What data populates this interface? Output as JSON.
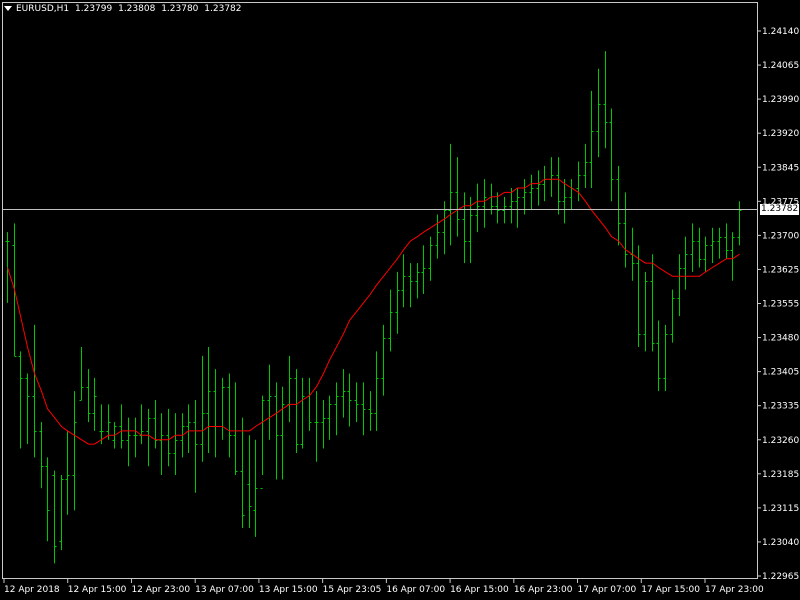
{
  "header": {
    "symbol": "EURUSD,H1",
    "ohlc": [
      "1.23799",
      "1.23808",
      "1.23780",
      "1.23782"
    ]
  },
  "current_price_label": "1.23782",
  "colors": {
    "background": "#000000",
    "bar": "#00c800",
    "moving_average": "#ff0000",
    "axis_text": "#ffffff",
    "frame": "#c8c8c8",
    "price_line": "#c0c0c0"
  },
  "chart_data": {
    "type": "ohlc",
    "title": "EURUSD,H1",
    "ylim": [
      1.22965,
      1.24215
    ],
    "y_ticks": [
      "1.24140",
      "1.24065",
      "1.23990",
      "1.23920",
      "1.23845",
      "1.23775",
      "1.23700",
      "1.23625",
      "1.23555",
      "1.23480",
      "1.23405",
      "1.23335",
      "1.23260",
      "1.23185",
      "1.23115",
      "1.23040",
      "1.22965"
    ],
    "x_ticks": [
      "12 Apr 2018",
      "12 Apr 15:00",
      "12 Apr 23:00",
      "13 Apr 07:00",
      "13 Apr 15:00",
      "15 Apr 23:05",
      "16 Apr 07:00",
      "16 Apr 15:00",
      "16 Apr 23:00",
      "17 Apr 07:00",
      "17 Apr 15:00",
      "17 Apr 23:00"
    ],
    "current_price": 1.23782,
    "grid": false,
    "series": [
      {
        "name": "",
        "type": "ohlc",
        "bars": [
          [
            1.2371,
            1.2373,
            1.2357,
            1.2371
          ],
          [
            1.237,
            1.2375,
            1.2345,
            1.2345
          ],
          [
            1.2345,
            1.2346,
            1.2324,
            1.234
          ],
          [
            1.234,
            1.2341,
            1.2325,
            1.2336
          ],
          [
            1.2336,
            1.2352,
            1.2322,
            1.2328
          ],
          [
            1.2328,
            1.233,
            1.2315,
            1.232
          ],
          [
            1.232,
            1.2322,
            1.2303,
            1.231
          ],
          [
            1.2318,
            1.2319,
            1.2298,
            1.2302
          ],
          [
            1.2303,
            1.2318,
            1.2301,
            1.2317
          ],
          [
            1.2317,
            1.2328,
            1.2309,
            1.2318
          ],
          [
            1.2318,
            1.2337,
            1.231,
            1.233
          ],
          [
            1.2335,
            1.2347,
            1.2335,
            1.2338
          ],
          [
            1.2338,
            1.2342,
            1.233,
            1.2332
          ],
          [
            1.2332,
            1.234,
            1.2328,
            1.2336
          ],
          [
            1.2328,
            1.2334,
            1.2325,
            1.2328
          ],
          [
            1.2328,
            1.2334,
            1.2326,
            1.233
          ],
          [
            1.2326,
            1.233,
            1.2324,
            1.2329
          ],
          [
            1.2329,
            1.2334,
            1.2324,
            1.2326
          ],
          [
            1.2326,
            1.2331,
            1.232,
            1.2327
          ],
          [
            1.2327,
            1.2331,
            1.2322,
            1.2327
          ],
          [
            1.2327,
            1.2334,
            1.2325,
            1.2328
          ],
          [
            1.2328,
            1.2333,
            1.232,
            1.2331
          ],
          [
            1.2331,
            1.2335,
            1.2324,
            1.2326
          ],
          [
            1.2326,
            1.2332,
            1.2318,
            1.2327
          ],
          [
            1.2327,
            1.2333,
            1.232,
            1.2323
          ],
          [
            1.2323,
            1.2332,
            1.2318,
            1.2326
          ],
          [
            1.2326,
            1.2332,
            1.2322,
            1.2329
          ],
          [
            1.2329,
            1.2334,
            1.2323,
            1.233
          ],
          [
            1.233,
            1.2335,
            1.2314,
            1.2325
          ],
          [
            1.2325,
            1.2345,
            1.2321,
            1.2332
          ],
          [
            1.2332,
            1.2347,
            1.2323,
            1.2337
          ],
          [
            1.2337,
            1.2342,
            1.2322,
            1.2329
          ],
          [
            1.2329,
            1.234,
            1.2326,
            1.2338
          ],
          [
            1.2338,
            1.2341,
            1.2322,
            1.2327
          ],
          [
            1.2327,
            1.2339,
            1.2318,
            1.2319
          ],
          [
            1.2319,
            1.2331,
            1.2306,
            1.2309
          ],
          [
            1.2316,
            1.2327,
            1.2306,
            1.2311
          ],
          [
            1.231,
            1.2326,
            1.2304,
            1.2315
          ],
          [
            1.2315,
            1.2336,
            1.2318,
            1.2335
          ],
          [
            1.2335,
            1.2343,
            1.2326,
            1.2336
          ],
          [
            1.2336,
            1.2339,
            1.2317,
            1.2327
          ],
          [
            1.2327,
            1.2338,
            1.2317,
            1.2334
          ],
          [
            1.2334,
            1.2345,
            1.233,
            1.234
          ],
          [
            1.234,
            1.2342,
            1.2323,
            1.2325
          ],
          [
            1.2325,
            1.234,
            1.2324,
            1.2336
          ],
          [
            1.2336,
            1.234,
            1.2328,
            1.233
          ],
          [
            1.233,
            1.2337,
            1.2321,
            1.233
          ],
          [
            1.233,
            1.2335,
            1.2324,
            1.2331
          ],
          [
            1.2331,
            1.2336,
            1.2326,
            1.2334
          ],
          [
            1.2334,
            1.2339,
            1.2327,
            1.2336
          ],
          [
            1.2336,
            1.2342,
            1.2331,
            1.2337
          ],
          [
            1.2337,
            1.2341,
            1.2329,
            1.2335
          ],
          [
            1.2335,
            1.2339,
            1.233,
            1.2334
          ],
          [
            1.2334,
            1.2339,
            1.2327,
            1.2333
          ],
          [
            1.2333,
            1.2337,
            1.2328,
            1.2332
          ],
          [
            1.2332,
            1.2346,
            1.2328,
            1.234
          ],
          [
            1.234,
            1.2352,
            1.2336,
            1.2349
          ],
          [
            1.2349,
            1.236,
            1.2346,
            1.2355
          ],
          [
            1.2355,
            1.2364,
            1.235,
            1.236
          ],
          [
            1.236,
            1.2368,
            1.2356,
            1.2363
          ],
          [
            1.2363,
            1.2366,
            1.2356,
            1.2362
          ],
          [
            1.2362,
            1.2366,
            1.2358,
            1.2364
          ],
          [
            1.2364,
            1.237,
            1.2359,
            1.2365
          ],
          [
            1.2365,
            1.2372,
            1.2362,
            1.237
          ],
          [
            1.237,
            1.2377,
            1.2367,
            1.2373
          ],
          [
            1.2373,
            1.238,
            1.2368,
            1.2378
          ],
          [
            1.2378,
            1.2393,
            1.237,
            1.2382
          ],
          [
            1.2382,
            1.239,
            1.2372,
            1.2376
          ],
          [
            1.2376,
            1.2382,
            1.2366,
            1.2371
          ],
          [
            1.2371,
            1.2381,
            1.2366,
            1.2377
          ],
          [
            1.2377,
            1.2384,
            1.2373,
            1.2379
          ],
          [
            1.2379,
            1.2385,
            1.2374,
            1.2381
          ],
          [
            1.2381,
            1.2384,
            1.2377,
            1.2379
          ],
          [
            1.2379,
            1.2382,
            1.2375,
            1.2378
          ],
          [
            1.2378,
            1.2381,
            1.2375,
            1.2379
          ],
          [
            1.2379,
            1.2383,
            1.2375,
            1.238
          ],
          [
            1.238,
            1.2383,
            1.2374,
            1.2381
          ],
          [
            1.2381,
            1.2385,
            1.2377,
            1.2382
          ],
          [
            1.2382,
            1.2386,
            1.2378,
            1.2383
          ],
          [
            1.2383,
            1.2387,
            1.2379,
            1.2384
          ],
          [
            1.2384,
            1.2388,
            1.238,
            1.2385
          ],
          [
            1.2385,
            1.239,
            1.2381,
            1.2386
          ],
          [
            1.2386,
            1.239,
            1.2377,
            1.238
          ],
          [
            1.238,
            1.2385,
            1.2375,
            1.2381
          ],
          [
            1.2381,
            1.2385,
            1.2378,
            1.2383
          ],
          [
            1.2383,
            1.2389,
            1.238,
            1.2386
          ],
          [
            1.2386,
            1.2393,
            1.2383,
            1.2389
          ],
          [
            1.2389,
            1.2405,
            1.2383,
            1.2396
          ],
          [
            1.2396,
            1.241,
            1.239,
            1.2402
          ],
          [
            1.2402,
            1.2414,
            1.2392,
            1.2398
          ],
          [
            1.2398,
            1.2401,
            1.238,
            1.2385
          ],
          [
            1.2385,
            1.2388,
            1.237,
            1.2375
          ],
          [
            1.2375,
            1.2382,
            1.2365,
            1.2368
          ],
          [
            1.2368,
            1.2374,
            1.2362,
            1.2366
          ],
          [
            1.2366,
            1.237,
            1.2347,
            1.235
          ],
          [
            1.235,
            1.2364,
            1.2346,
            1.2362
          ],
          [
            1.2362,
            1.2368,
            1.2346,
            1.2348
          ],
          [
            1.2348,
            1.2353,
            1.2337,
            1.234
          ],
          [
            1.234,
            1.2352,
            1.2337,
            1.235
          ],
          [
            1.235,
            1.236,
            1.2348,
            1.2358
          ],
          [
            1.2358,
            1.2368,
            1.2354,
            1.2365
          ],
          [
            1.2365,
            1.2372,
            1.236,
            1.2368
          ],
          [
            1.2368,
            1.2375,
            1.2364,
            1.2371
          ],
          [
            1.2371,
            1.2374,
            1.2365,
            1.2367
          ],
          [
            1.2367,
            1.2372,
            1.2364,
            1.237
          ],
          [
            1.237,
            1.2374,
            1.2366,
            1.2371
          ],
          [
            1.2371,
            1.2374,
            1.2367,
            1.2372
          ],
          [
            1.2372,
            1.2375,
            1.2367,
            1.2369
          ],
          [
            1.2369,
            1.2373,
            1.2362,
            1.2372
          ],
          [
            1.2372,
            1.238,
            1.237,
            1.2378
          ]
        ]
      },
      {
        "name": "",
        "type": "line",
        "values": [
          1.2365,
          1.236,
          1.2354,
          1.2347,
          1.2341,
          1.2337,
          1.2333,
          1.2331,
          1.2329,
          1.2328,
          1.2327,
          1.2326,
          1.2325,
          1.2325,
          1.2326,
          1.2327,
          1.2327,
          1.2328,
          1.2328,
          1.2328,
          1.2327,
          1.2327,
          1.2326,
          1.2326,
          1.2326,
          1.2327,
          1.2327,
          1.2328,
          1.2328,
          1.2328,
          1.2329,
          1.2329,
          1.2329,
          1.2328,
          1.2328,
          1.2328,
          1.2328,
          1.2329,
          1.233,
          1.2331,
          1.2332,
          1.2333,
          1.2334,
          1.2334,
          1.2335,
          1.2336,
          1.2338,
          1.2341,
          1.2344,
          1.2347,
          1.235,
          1.2353,
          1.2355,
          1.2357,
          1.2359,
          1.2361,
          1.2363,
          1.2365,
          1.2367,
          1.2369,
          1.2371,
          1.2372,
          1.2373,
          1.2374,
          1.2375,
          1.2376,
          1.2377,
          1.2378,
          1.2379,
          1.2379,
          1.238,
          1.238,
          1.2381,
          1.2381,
          1.2382,
          1.2382,
          1.2383,
          1.2383,
          1.2384,
          1.2384,
          1.2385,
          1.2385,
          1.2385,
          1.2384,
          1.2383,
          1.2382,
          1.238,
          1.2378,
          1.2376,
          1.2374,
          1.2372,
          1.2371,
          1.2369,
          1.2368,
          1.2367,
          1.2366,
          1.2366,
          1.2365,
          1.2364,
          1.2363,
          1.2363,
          1.2363,
          1.2363,
          1.2363,
          1.2364,
          1.2365,
          1.2366,
          1.2367,
          1.2367,
          1.2368
        ]
      }
    ]
  }
}
